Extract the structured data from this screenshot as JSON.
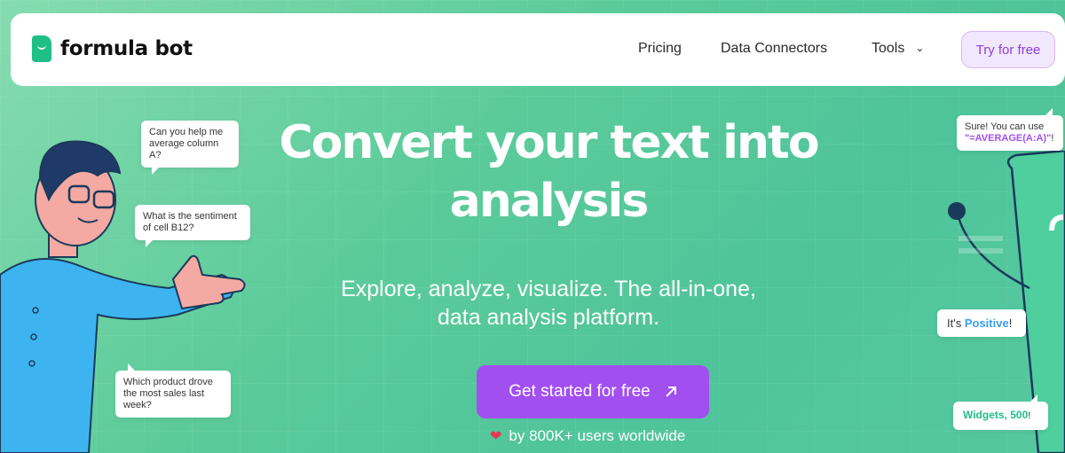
{
  "nav": {
    "logo_text": "formula bot",
    "links": [
      "Pricing",
      "Data Connectors",
      "Tools"
    ],
    "try_label": "Try for free"
  },
  "hero": {
    "title_line1": "Convert your text into",
    "title_line2": "analysis",
    "subtitle_line1": "Explore, analyze, visualize. The all-in-one,",
    "subtitle_line2": "data analysis platform.",
    "cta_label": "Get started for free",
    "social_proof": "by 800K+ users worldwide"
  },
  "bubbles": {
    "q1": "Can you help me average column A?",
    "q2": "What is the sentiment of cell B12?",
    "q3": "Which product drove the most sales last week?",
    "a1_prefix": "Sure! You can use",
    "a1_formula": "\"=AVERAGE(A:A)\"",
    "a1_suffix": "!",
    "a2_prefix": "It's ",
    "a2_value": "Positive",
    "a2_suffix": "!",
    "a3_value": "Widgets, 500",
    "a3_suffix": "!"
  },
  "icons": {
    "logo": "logo-icon",
    "tools_chevron": "chevron-down-icon",
    "cta_arrow": "arrow-up-right-icon",
    "heart": "heart-icon"
  },
  "colors": {
    "accent": "#a24ff0",
    "brand_green": "#1fbf86",
    "positive_blue": "#3a9ff0"
  }
}
